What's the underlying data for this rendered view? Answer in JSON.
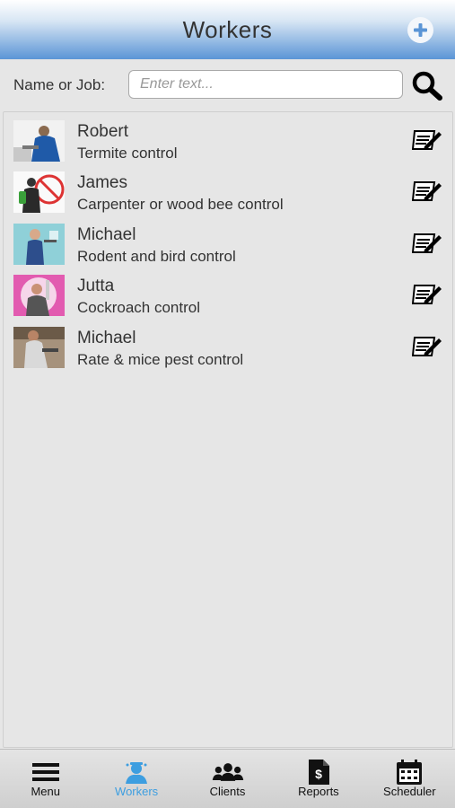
{
  "header": {
    "title": "Workers",
    "add_icon": "plus-circle-icon"
  },
  "search": {
    "label": "Name or Job:",
    "placeholder": "Enter text...",
    "value": "",
    "icon": "magnifier-icon"
  },
  "workers": [
    {
      "name": "Robert",
      "job": "Termite control",
      "avatar_icon": "worker-photo"
    },
    {
      "name": "James",
      "job": "Carpenter or wood bee control",
      "avatar_icon": "worker-photo"
    },
    {
      "name": "Michael",
      "job": "Rodent and bird control",
      "avatar_icon": "worker-photo"
    },
    {
      "name": "Jutta",
      "job": "Cockroach control",
      "avatar_icon": "worker-photo"
    },
    {
      "name": "Michael",
      "job": "Rate & mice pest control",
      "avatar_icon": "worker-photo"
    }
  ],
  "tabs": [
    {
      "label": "Menu",
      "icon": "hamburger-icon",
      "active": false
    },
    {
      "label": "Workers",
      "icon": "worker-icon",
      "active": true
    },
    {
      "label": "Clients",
      "icon": "people-icon",
      "active": false
    },
    {
      "label": "Reports",
      "icon": "report-document-icon",
      "active": false
    },
    {
      "label": "Scheduler",
      "icon": "calendar-icon",
      "active": false
    }
  ],
  "colors": {
    "header_top": "#ffffff",
    "header_bottom": "#5b95d6",
    "active_tab": "#3d9ee0",
    "background": "#e6e6e6"
  }
}
